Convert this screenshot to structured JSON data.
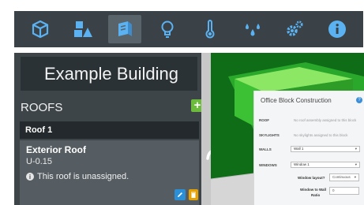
{
  "toolbar": {
    "icons": [
      "cube-icon",
      "building-users-icon",
      "walls-icon",
      "lightbulb-icon",
      "thermometer-icon",
      "water-drops-icon",
      "gears-icon",
      "info-icon"
    ],
    "active_index": 2
  },
  "panel": {
    "building_name": "Example Building",
    "section_title": "ROOFS",
    "roof": {
      "name": "Roof 1",
      "type": "Exterior Roof",
      "u_value": "U-0.15",
      "warning": "This roof is unassigned."
    }
  },
  "popup": {
    "title": "Office Block Construction",
    "rows": [
      {
        "label": "ROOF",
        "value": "No roof assembly assigned to this block"
      },
      {
        "label": "SKYLIGHTS",
        "value": "No skylights assigned to this block"
      }
    ],
    "walls_label": "WALLS",
    "walls_value": "Wall 1",
    "windows_label": "WINDOWS",
    "windows_value": "Window 1",
    "window_layout_label": "Window layout?",
    "window_layout_value": "Continuous",
    "ratio_label_1": "Window to Wall",
    "ratio_label_2": "Ratio",
    "ratio_value": "0"
  },
  "colors": {
    "toolbar_bg": "#3a4247",
    "panel_bg": "#3d4549",
    "viewport_bg": "#0f6d18",
    "accent_green": "#6dbb3c",
    "edit_blue": "#2a8fd6",
    "delete_orange": "#e6a200"
  }
}
